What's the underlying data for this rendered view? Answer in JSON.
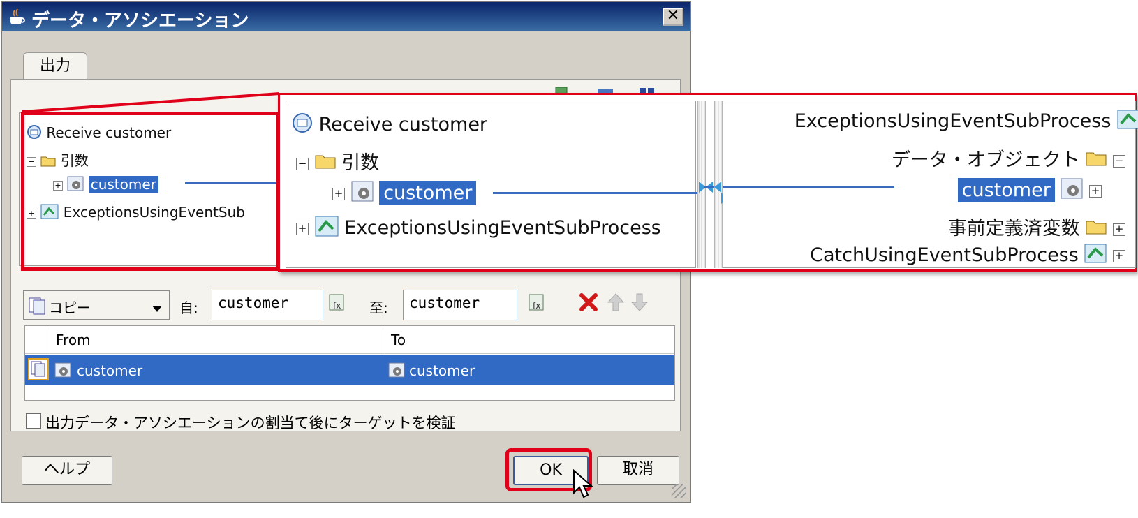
{
  "window": {
    "title": "データ・アソシエーション",
    "close_glyph": "✕"
  },
  "tab": {
    "label": "出力"
  },
  "tree": {
    "receive": "Receive customer",
    "args": "引数",
    "customer": "customer",
    "process": "ExceptionsUsingEventSub"
  },
  "zoom": {
    "left": {
      "receive": "Receive customer",
      "args": "引数",
      "customer": "customer",
      "process": "ExceptionsUsingEventSubProcess"
    },
    "right": {
      "process": "ExceptionsUsingEventSubProcess",
      "data_object": "データ・オブジェクト",
      "customer": "customer",
      "predefined": "事前定義済変数",
      "catch": "CatchUsingEventSubProcess"
    }
  },
  "controls": {
    "operation": "コピー",
    "from_label": "自:",
    "from_value": "customer",
    "to_label": "至:",
    "to_value": "customer"
  },
  "table": {
    "headers": [
      "From",
      "To"
    ],
    "rows": [
      {
        "from": "customer",
        "to": "customer"
      }
    ]
  },
  "validate_label": "出力データ・アソシエーションの割当て後にターゲットを検証",
  "buttons": {
    "help": "ヘルプ",
    "ok": "OK",
    "cancel": "取消"
  },
  "colors": {
    "selection": "#316ac5",
    "highlight": "#e0001a",
    "titlebar": "#0a246a"
  }
}
